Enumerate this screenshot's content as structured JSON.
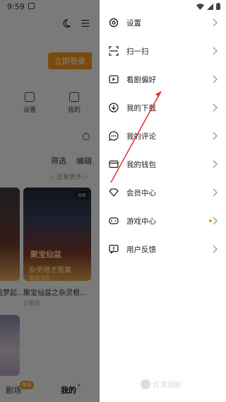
{
  "status_bar": {
    "time": "9:59"
  },
  "background": {
    "login_button": "立即登录",
    "quick_items": [
      "设置",
      "我的"
    ],
    "filter_labels": [
      "筛选",
      "编辑"
    ],
    "hint": "◁ 查看更多 ▷",
    "poster": {
      "tag": "独家",
      "name": "聚宝仙盆",
      "sub": "杂灵根才是真BOSS"
    },
    "poster_title": "聚宝仙盆之杂灵根...",
    "poster_progress": "已看到",
    "left_title": "追梦起...",
    "tabs": [
      {
        "label": "剧场",
        "badge": "推荐"
      },
      {
        "label": "我的"
      }
    ]
  },
  "drawer": {
    "items": [
      {
        "label": "设置",
        "icon": "gear-icon"
      },
      {
        "label": "扫一扫",
        "icon": "scan-icon"
      },
      {
        "label": "看剧偏好",
        "icon": "play-preference-icon"
      },
      {
        "label": "我的下载",
        "icon": "download-icon"
      },
      {
        "label": "我的评论",
        "icon": "comment-icon"
      },
      {
        "label": "我的钱包",
        "icon": "wallet-icon"
      },
      {
        "label": "会员中心",
        "icon": "diamond-icon"
      },
      {
        "label": "游戏中心",
        "icon": "gamepad-icon",
        "has_dot": true
      },
      {
        "label": "用户反馈",
        "icon": "feedback-icon"
      }
    ],
    "watermark": "红果短剧"
  },
  "colors": {
    "accent": "#f2971a",
    "arrow": "#e03030",
    "overlay": "rgba(0,0,0,0.5)"
  }
}
